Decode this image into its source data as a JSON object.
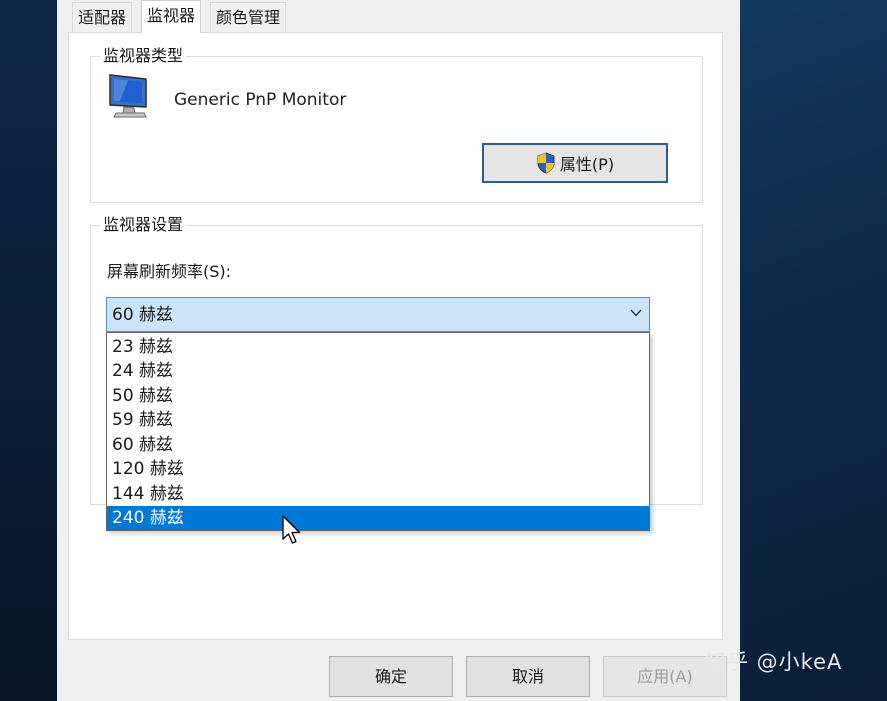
{
  "tabs": [
    {
      "label": "适配器",
      "active": false
    },
    {
      "label": "监视器",
      "active": true
    },
    {
      "label": "颜色管理",
      "active": false
    }
  ],
  "monitor_type": {
    "group_title": "监视器类型",
    "monitor_name": "Generic PnP Monitor",
    "properties_button": "属性(P)",
    "icon": "monitor-icon"
  },
  "monitor_settings": {
    "group_title": "监视器设置",
    "refresh_label": "屏幕刷新频率(S):",
    "selected_value": "60 赫兹",
    "options": [
      "23 赫兹",
      "24 赫兹",
      "50 赫兹",
      "59 赫兹",
      "60 赫兹",
      "120 赫兹",
      "144 赫兹",
      "240 赫兹"
    ],
    "highlighted_option": "240 赫兹"
  },
  "buttons": {
    "ok": "确定",
    "cancel": "取消",
    "apply": "应用(A)"
  },
  "watermark": "知乎 @小keA",
  "colors": {
    "accent": "#0078d7",
    "combo_bg": "#cce4f7",
    "dialog_bg": "#f0f0f0"
  }
}
